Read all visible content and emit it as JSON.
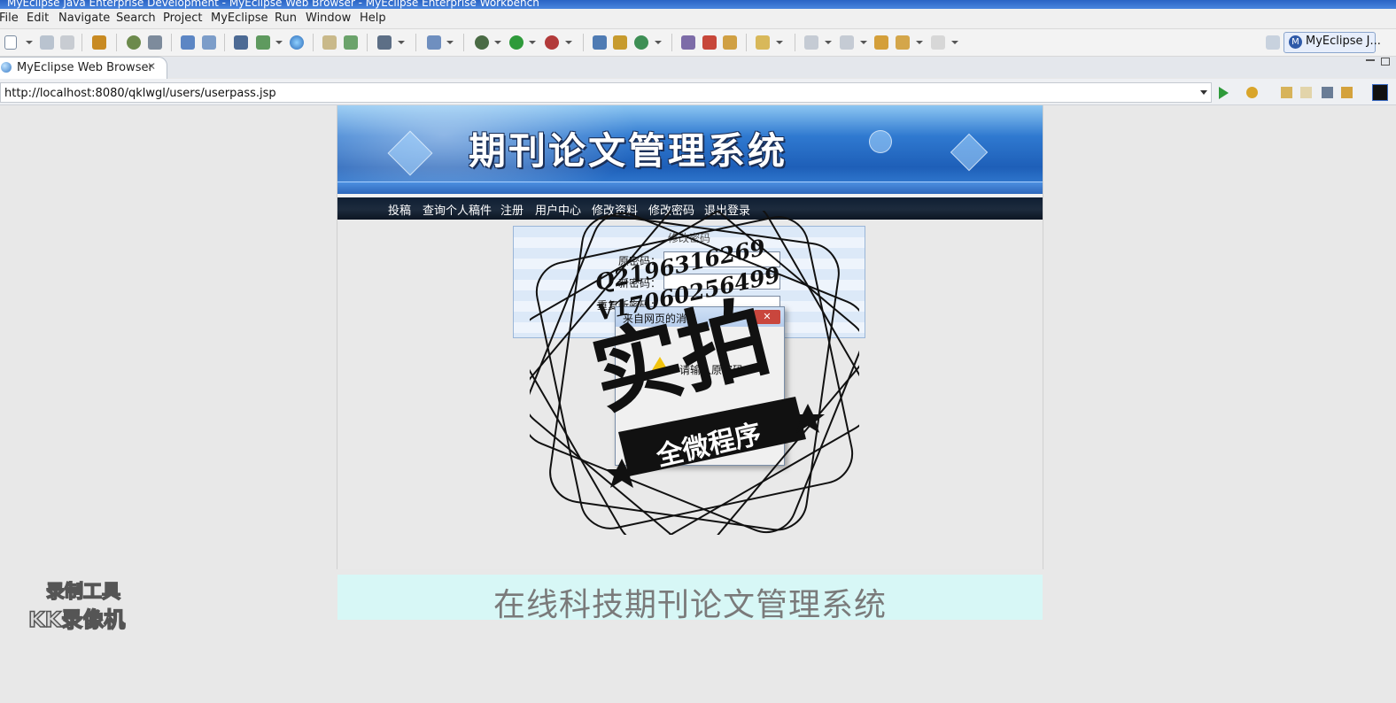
{
  "window": {
    "title": "MyEclipse Java Enterprise Development - MyEclipse Web Browser - MyEclipse Enterprise Workbench"
  },
  "menu": [
    "File",
    "Edit",
    "Navigate",
    "Search",
    "Project",
    "MyEclipse",
    "Run",
    "Window",
    "Help"
  ],
  "perspective": {
    "label": "MyEclipse J...",
    "badge": "M"
  },
  "editor_tab": {
    "label": "MyEclipse Web Browser",
    "close": "✕"
  },
  "browser": {
    "url": "http://localhost:8080/qklwgl/users/userpass.jsp"
  },
  "site": {
    "banner_title": "期刊论文管理系统",
    "nav": [
      "投稿",
      "查询个人稿件",
      "注册",
      "用户中心",
      "修改资料",
      "修改密码",
      "退出登录"
    ],
    "form": {
      "title": "修改密码",
      "old_label": "原密码：",
      "new_label": "新密码：",
      "repeat_label": "重复新密码："
    },
    "footer": "在线科技期刊论文管理系统"
  },
  "dialog": {
    "title": "来自网页的消息",
    "close": "✕",
    "message": "请输入原密码",
    "ok": "确定"
  },
  "overlay_watermark": {
    "contact_q": "Q2196316269",
    "contact_v": "V17060256499",
    "main": "实拍",
    "ribbon": "全微程序"
  },
  "recorder_watermark": {
    "line1": "录制工具",
    "line2": "KK录像机"
  },
  "colors": {
    "title_bar": "#2a64c5",
    "banner": "#1e5fb8",
    "nav_bar": "#0f1f33",
    "footer_bg": "#d7f7f6",
    "footer_text": "#7a7a7a"
  }
}
